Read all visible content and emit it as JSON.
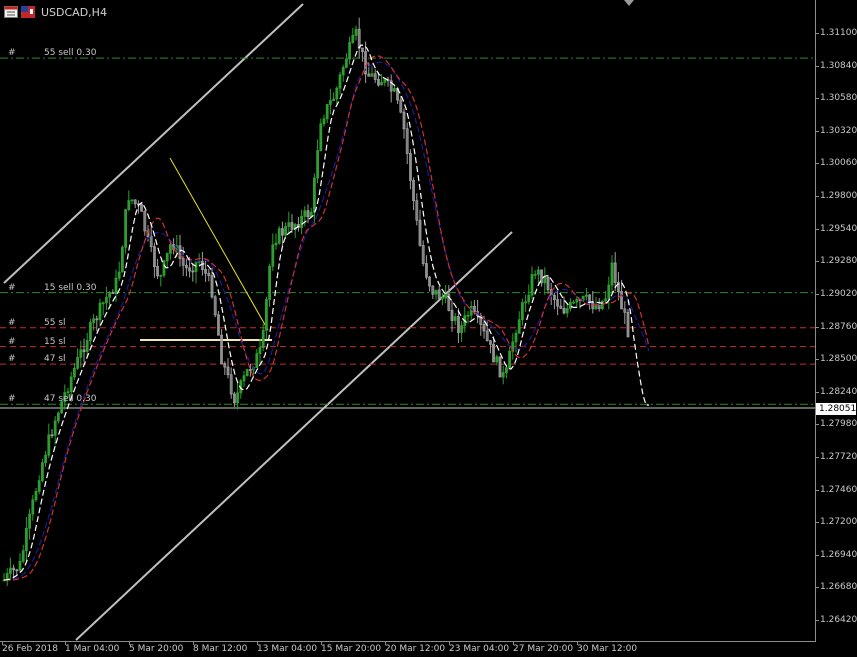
{
  "window": {
    "symbol_title": "USDCAD,H4"
  },
  "colors": {
    "background": "#000000",
    "bull_candle": "#2e9e2e",
    "bear_candle": "#a0a0a0",
    "ma_fast": "#ffffff",
    "ma_mid": "#d03030",
    "ma_slow": "#1a1a9a",
    "trend_channel": "#c0c0c0",
    "triangle_line": "#e8e020",
    "green_level": "#2a8a2a",
    "red_level": "#c03030",
    "current_price_bg": "#ffffff"
  },
  "price_axis": {
    "labels": [
      "1.31100",
      "1.30840",
      "1.30580",
      "1.30320",
      "1.30060",
      "1.29800",
      "1.29540",
      "1.29280",
      "1.29020",
      "1.28760",
      "1.28500",
      "1.28240",
      "1.27980",
      "1.27720",
      "1.27460",
      "1.27200",
      "1.26940",
      "1.26680",
      "1.26420"
    ],
    "current_price": "1.28051"
  },
  "time_axis": {
    "labels": [
      "26 Feb 2018",
      "1 Mar 04:00",
      "5 Mar 20:00",
      "8 Mar 12:00",
      "13 Mar 04:00",
      "15 Mar 20:00",
      "20 Mar 12:00",
      "23 Mar 04:00",
      "27 Mar 20:00",
      "30 Mar 12:00"
    ]
  },
  "levels": [
    {
      "prefix": "#",
      "label": "55 sell 0.30",
      "price": 1.309,
      "kind": "green"
    },
    {
      "prefix": "#",
      "label": "15 sell 0.30",
      "price": 1.2903,
      "kind": "green"
    },
    {
      "prefix": "#",
      "label": "55 sl",
      "price": 1.2875,
      "kind": "red"
    },
    {
      "prefix": "#",
      "label": "15 sl",
      "price": 1.286,
      "kind": "red"
    },
    {
      "prefix": "#",
      "label": "47 sl",
      "price": 1.2846,
      "kind": "red"
    },
    {
      "prefix": "#",
      "label": "47 sell 0.30",
      "price": 1.2814,
      "kind": "green"
    }
  ]
}
